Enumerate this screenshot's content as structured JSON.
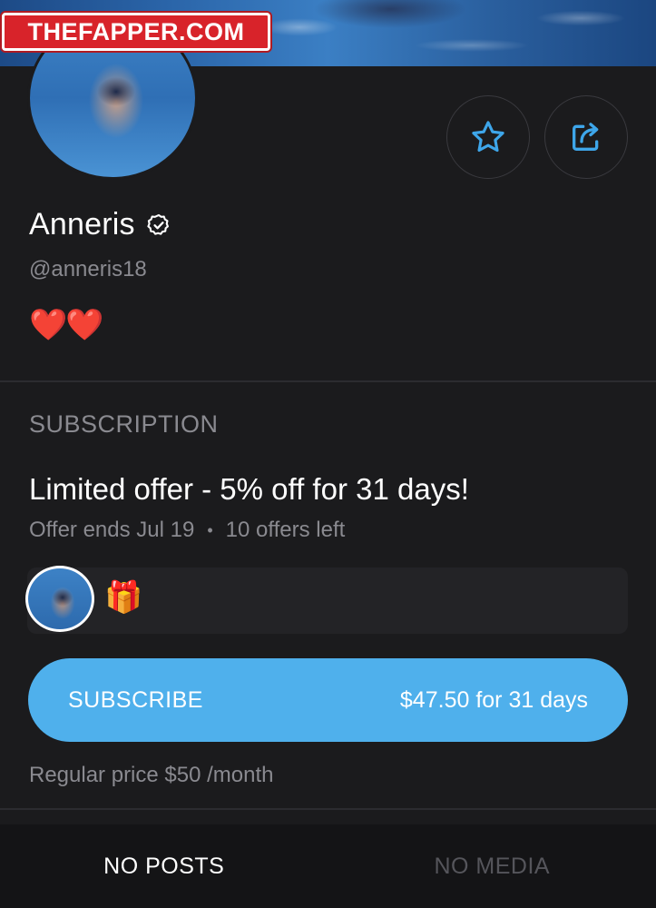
{
  "watermark": {
    "text": "THEFAPPER.COM"
  },
  "profile": {
    "name": "Anneris",
    "handle": "@anneris18",
    "bio": "❤️❤️",
    "verified_icon": "verified-badge-icon"
  },
  "actions": {
    "favorite_icon": "star-icon",
    "share_icon": "share-icon"
  },
  "subscription": {
    "heading": "SUBSCRIPTION",
    "offer_title": "Limited offer - 5% off for 31 days!",
    "offer_ends": "Offer ends Jul 19",
    "separator": "•",
    "offers_left": "10 offers left",
    "gift": "🎁",
    "subscribe_label": "SUBSCRIBE",
    "subscribe_price": "$47.50 for 31 days",
    "regular_price": "Regular price $50 /month"
  },
  "tabs": [
    {
      "label": "NO POSTS",
      "active": true
    },
    {
      "label": "NO MEDIA",
      "active": false
    }
  ],
  "colors": {
    "background": "#1b1b1d",
    "accent": "#4fb0ec",
    "icon_blue": "#3ea6ea",
    "muted_text": "#8a8a90",
    "watermark_red": "#d8232a"
  }
}
